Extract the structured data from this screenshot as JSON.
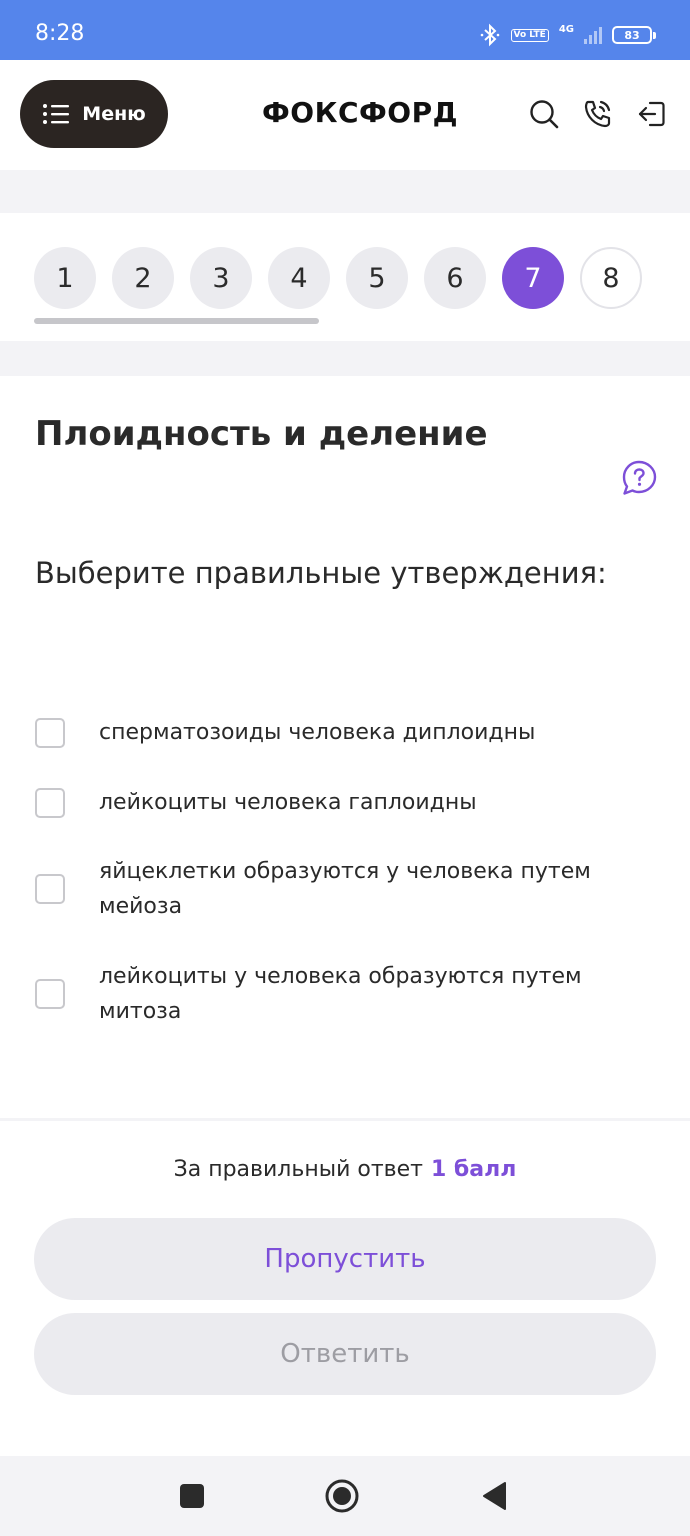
{
  "status_bar": {
    "time": "8:28",
    "volte": "Vo LTE",
    "network": "4G",
    "battery": "83",
    "icons": [
      "bluetooth-icon",
      "volte-icon",
      "signal-icon",
      "battery-icon"
    ]
  },
  "header": {
    "menu_label": "Меню",
    "logo": "ФОКСФОРД",
    "icons": [
      "menu-icon",
      "search-icon",
      "phone-icon",
      "logout-icon"
    ]
  },
  "steps": {
    "items": [
      "1",
      "2",
      "3",
      "4",
      "5",
      "6",
      "7",
      "8"
    ],
    "current": "7",
    "answered_count": 4
  },
  "question": {
    "title": "Плоидность и деление",
    "text": "Выберите правильные утверждения:",
    "options": [
      {
        "label": "сперматозоиды человека диплоидны",
        "checked": false
      },
      {
        "label": "лейкоциты человека гаплоидны",
        "checked": false
      },
      {
        "label": "яйцеклетки образуются у человека путем мейоза",
        "checked": false
      },
      {
        "label": "лейкоциты у человека образуются путем митоза",
        "checked": false
      }
    ]
  },
  "footer": {
    "points_label": "За правильный ответ",
    "points_value": "1 балл",
    "skip_label": "Пропустить",
    "answer_label": "Ответить"
  },
  "colors": {
    "status_bar": "#5585eb",
    "accent": "#7d4fd8",
    "menu_button": "#2b2522",
    "button_bg": "#ebebef"
  },
  "navbar": {
    "icons": [
      "recents-square-icon",
      "home-circle-icon",
      "back-triangle-icon"
    ]
  }
}
